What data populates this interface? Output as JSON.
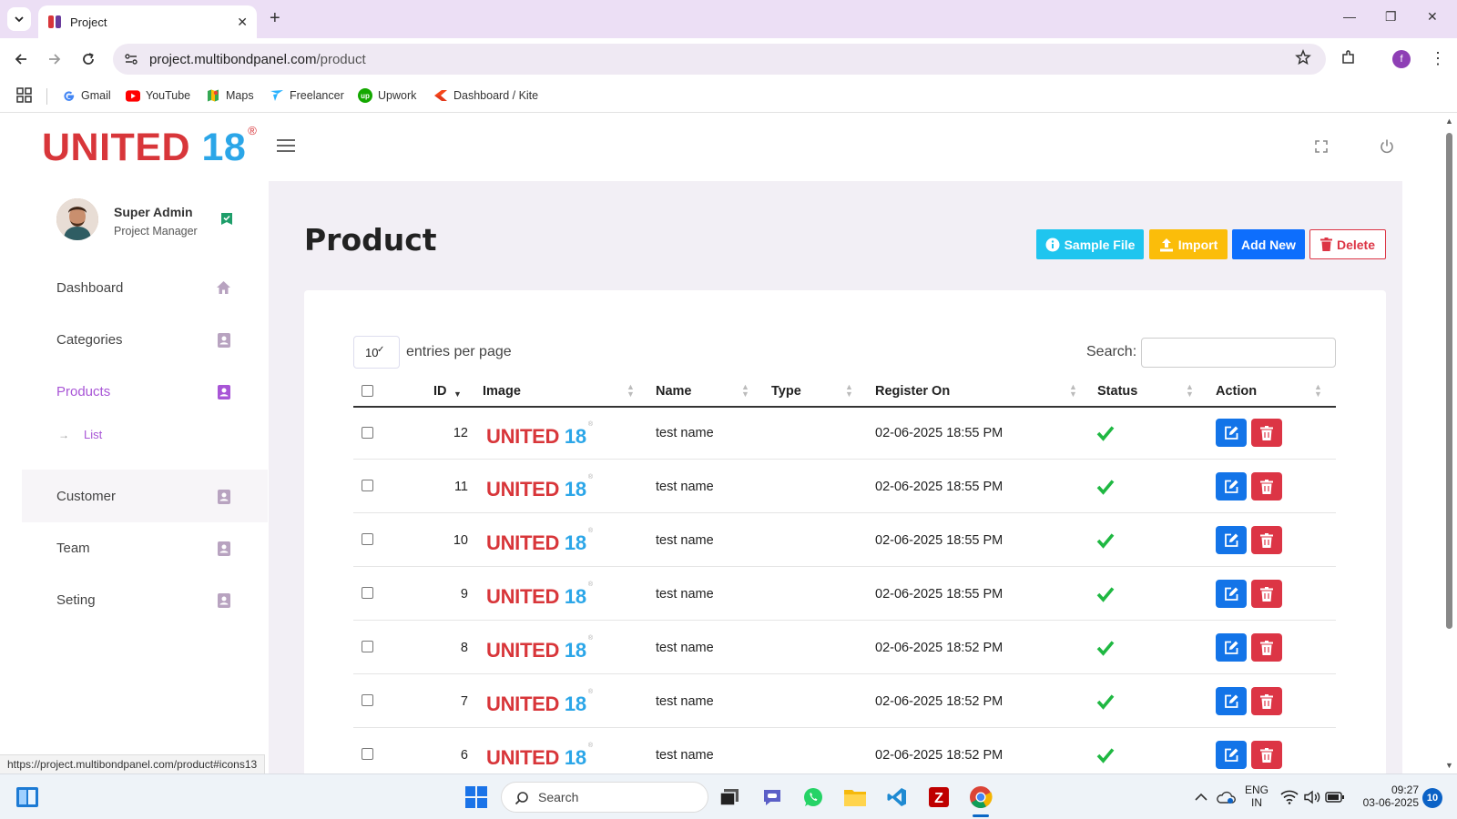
{
  "browser": {
    "tab_title": "Project",
    "url_domain": "project.multibondpanel.com",
    "url_path": "/product",
    "profile_initial": "f",
    "status_url": "https://project.multibondpanel.com/product#icons13",
    "bookmarks": [
      {
        "label": "Gmail",
        "icon": "gmail-icon"
      },
      {
        "label": "YouTube",
        "icon": "youtube-icon"
      },
      {
        "label": "Maps",
        "icon": "maps-icon"
      },
      {
        "label": "Freelancer",
        "icon": "freelancer-icon"
      },
      {
        "label": "Upwork",
        "icon": "upwork-icon"
      },
      {
        "label": "Dashboard / Kite",
        "icon": "kite-icon"
      }
    ]
  },
  "brand": {
    "part1": "UNITED",
    "part2": "18",
    "reg": "®",
    "red": "#d8363a",
    "blue": "#2ba6e8"
  },
  "user": {
    "name": "Super Admin",
    "role": "Project Manager"
  },
  "sidebar": {
    "items": [
      {
        "label": "Dashboard",
        "icon": "home-icon"
      },
      {
        "label": "Categories",
        "icon": "contact-book-icon"
      },
      {
        "label": "Products",
        "icon": "contact-book-icon",
        "active": true
      },
      {
        "label": "Customer",
        "icon": "contact-book-icon"
      },
      {
        "label": "Team",
        "icon": "contact-book-icon"
      },
      {
        "label": "Seting",
        "icon": "contact-book-icon"
      }
    ],
    "sub_item": "List",
    "accent": "#a855d6"
  },
  "page": {
    "title": "Product",
    "buttons": {
      "sample": "Sample File",
      "import": "Import",
      "add": "Add New",
      "delete": "Delete"
    }
  },
  "table": {
    "entries_value": "10",
    "entries_label": "entries per page",
    "search_label": "Search:",
    "columns": [
      "ID",
      "Image",
      "Name",
      "Type",
      "Register On",
      "Status",
      "Action"
    ],
    "rows": [
      {
        "id": "12",
        "name": "test name",
        "type": "",
        "registered": "02-06-2025 18:55 PM",
        "status": "active"
      },
      {
        "id": "11",
        "name": "test name",
        "type": "",
        "registered": "02-06-2025 18:55 PM",
        "status": "active"
      },
      {
        "id": "10",
        "name": "test name",
        "type": "",
        "registered": "02-06-2025 18:55 PM",
        "status": "active"
      },
      {
        "id": "9",
        "name": "test name",
        "type": "",
        "registered": "02-06-2025 18:55 PM",
        "status": "active"
      },
      {
        "id": "8",
        "name": "test name",
        "type": "",
        "registered": "02-06-2025 18:52 PM",
        "status": "active"
      },
      {
        "id": "7",
        "name": "test name",
        "type": "",
        "registered": "02-06-2025 18:52 PM",
        "status": "active"
      },
      {
        "id": "6",
        "name": "test name",
        "type": "",
        "registered": "02-06-2025 18:52 PM",
        "status": "active"
      }
    ]
  },
  "taskbar": {
    "search_placeholder": "Search",
    "lang1": "ENG",
    "lang2": "IN",
    "time": "09:27",
    "date": "03-06-2025",
    "notifications": "10"
  }
}
